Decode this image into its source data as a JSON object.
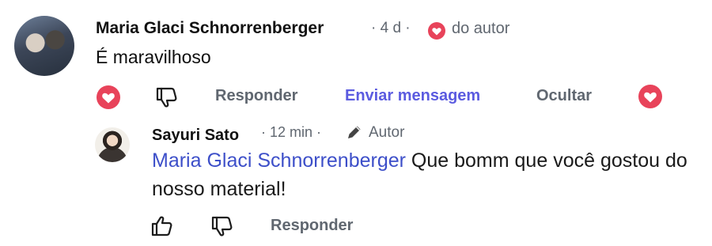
{
  "comment": {
    "author": "Maria Glaci Schnorrenberger",
    "meta": "· 4 d ·",
    "author_badge": "do autor",
    "text": "É maravilhoso",
    "actions": {
      "reply": "Responder",
      "send_message": "Enviar mensagem",
      "hide": "Ocultar"
    }
  },
  "reply": {
    "author": "Sayuri Sato",
    "meta": "· 12 min ·",
    "role": "Autor",
    "mention": "Maria Glaci Schnorrenberger",
    "text": " Que bomm que você gostou do nosso material!",
    "actions": {
      "reply": "Responder"
    }
  },
  "colors": {
    "heart": "#e8435a",
    "link": "#5b5be0",
    "mention": "#3d4fc9",
    "muted": "#606770"
  },
  "icons": [
    "avatar",
    "heart-icon",
    "thumbs-down-icon",
    "thumbs-up-icon",
    "pen-icon"
  ]
}
